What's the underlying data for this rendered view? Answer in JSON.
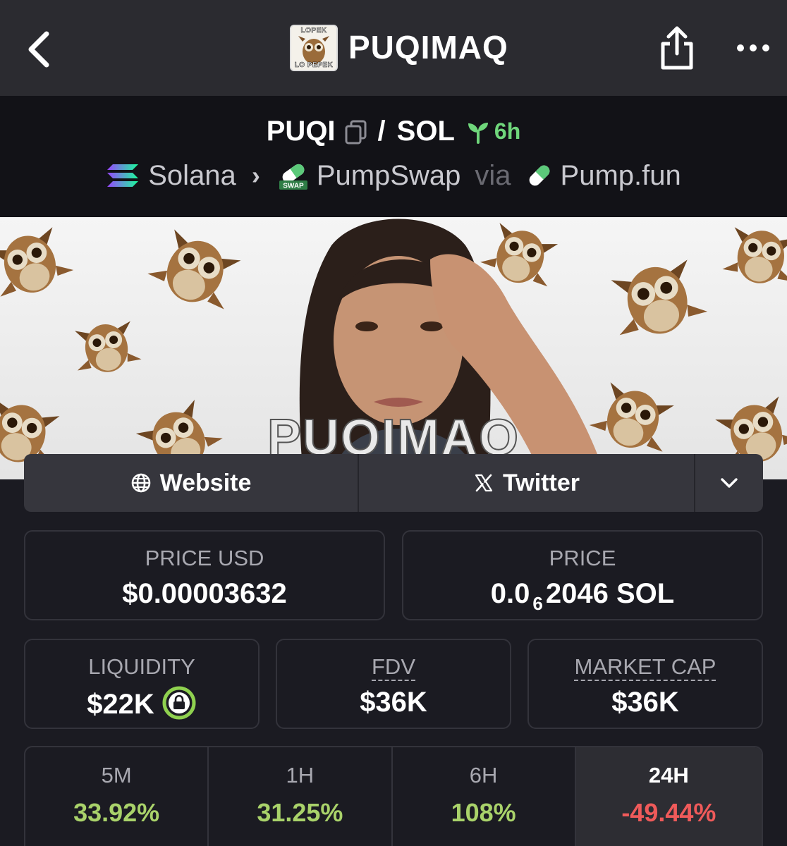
{
  "top_bar": {
    "title": "PUQIMAQ",
    "logo_text_top": "LOPEK",
    "logo_text_bottom": "LO PEPEK"
  },
  "pair": {
    "base": "PUQI",
    "separator": "/",
    "quote": "SOL",
    "age": "6h"
  },
  "route": {
    "chain": "Solana",
    "dex": "PumpSwap",
    "via": "via",
    "launchpad": "Pump.fun"
  },
  "banner": {
    "caption": "PUQIMAQ"
  },
  "links": {
    "website": "Website",
    "twitter": "Twitter"
  },
  "stats": {
    "price_usd_label": "PRICE USD",
    "price_usd_value": "$0.00003632",
    "price_label": "PRICE",
    "price_value_prefix": "0.0",
    "price_value_subscript": "6",
    "price_value_suffix": "2046 SOL",
    "liquidity_label": "LIQUIDITY",
    "liquidity_value": "$22K",
    "fdv_label": "FDV",
    "fdv_value": "$36K",
    "mcap_label": "MARKET CAP",
    "mcap_value": "$36K"
  },
  "timeframes": [
    {
      "label": "5M",
      "value": "33.92%",
      "color": "#a9d26a"
    },
    {
      "label": "1H",
      "value": "31.25%",
      "color": "#a9d26a"
    },
    {
      "label": "6H",
      "value": "108%",
      "color": "#a9d26a"
    },
    {
      "label": "24H",
      "value": "-49.44%",
      "color": "#ef5a5a",
      "active": true
    }
  ],
  "colors": {
    "positive": "#a9d26a",
    "negative": "#ef5a5a",
    "age_green": "#6fd67b",
    "lock_green": "#8fd14f"
  }
}
